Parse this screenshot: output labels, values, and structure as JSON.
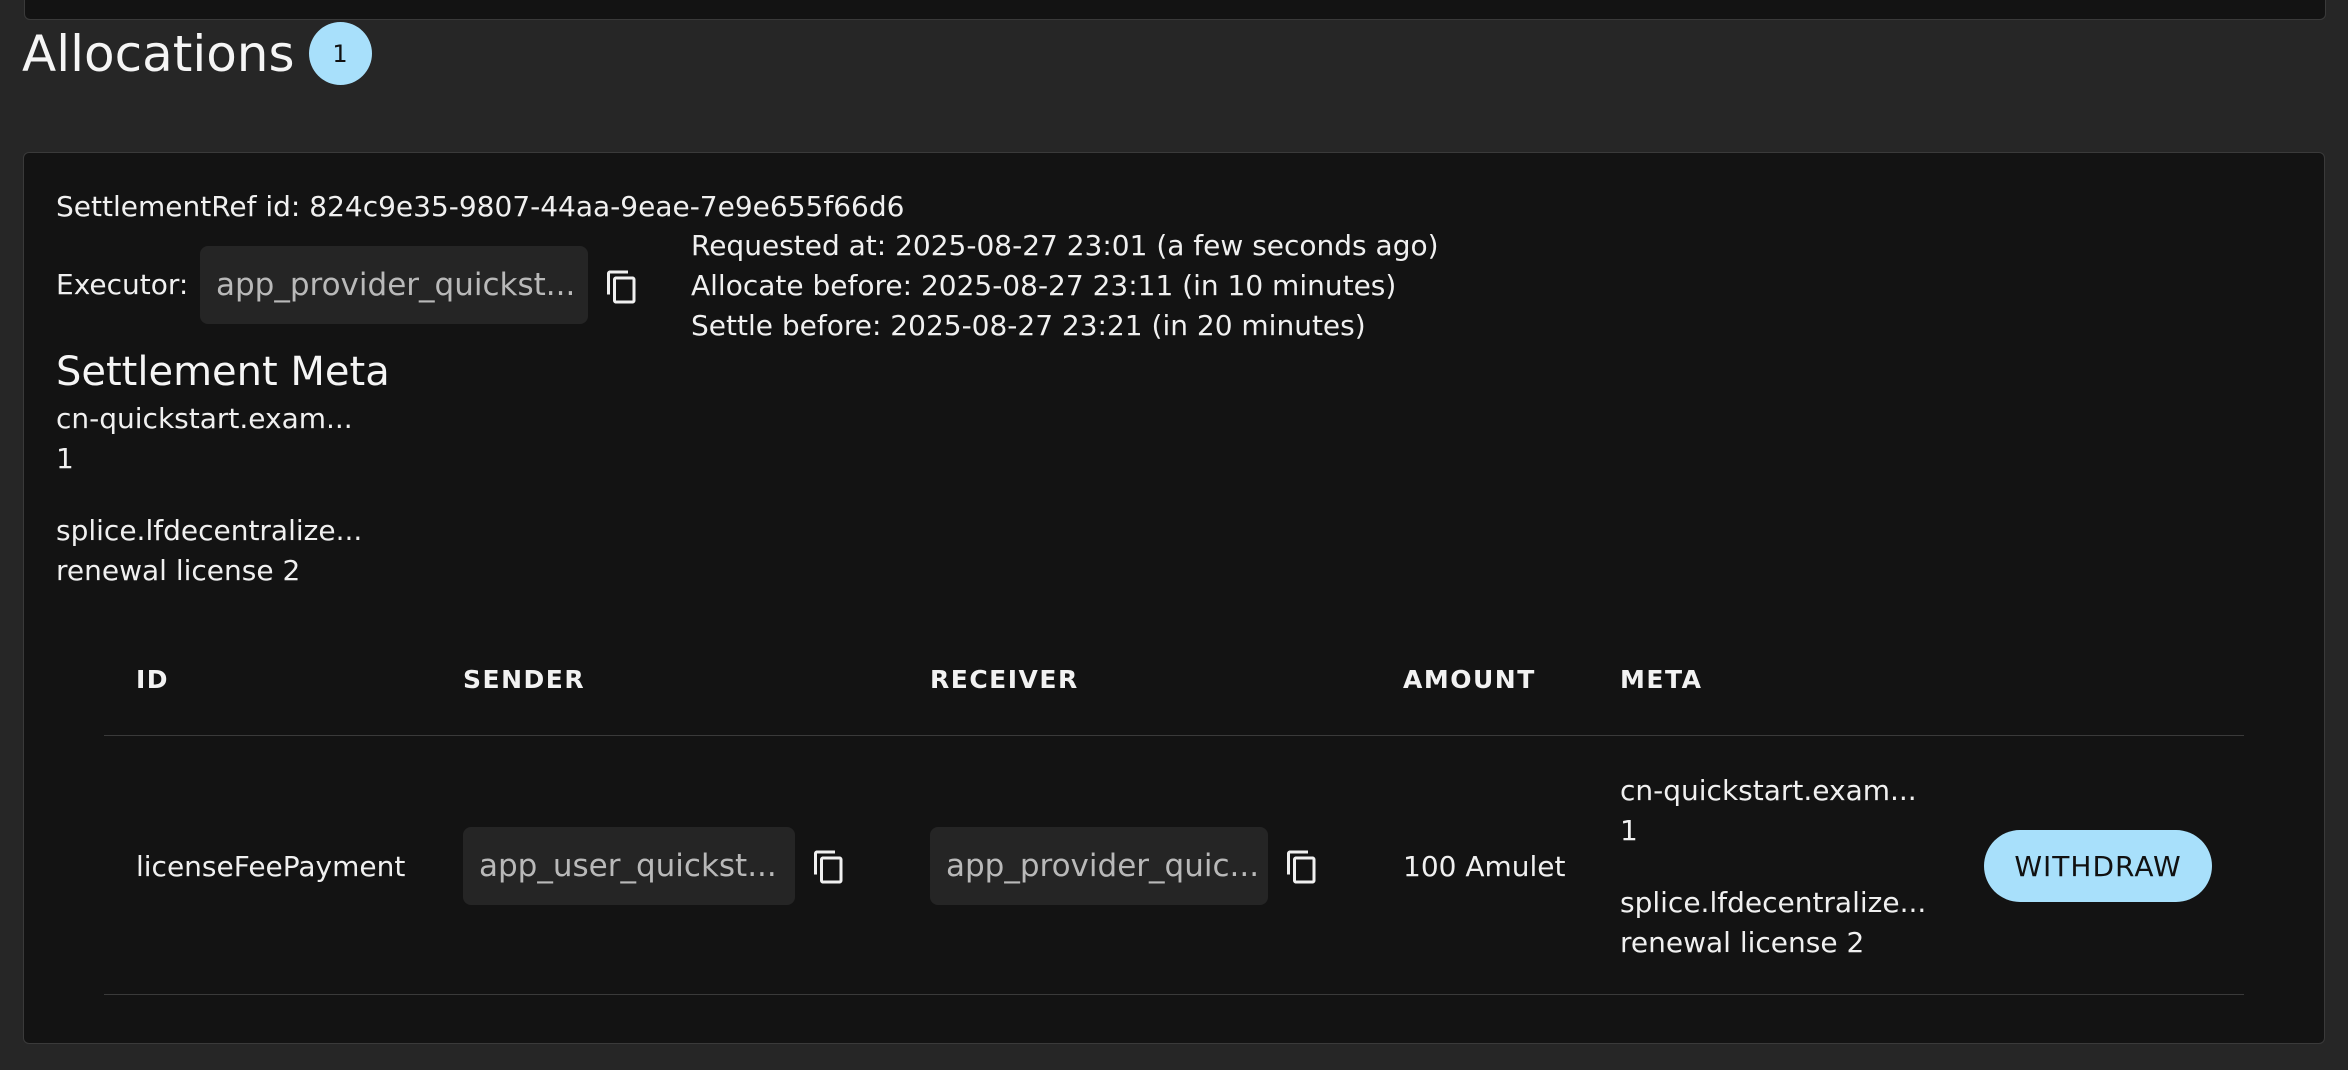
{
  "section": {
    "title": "Allocations",
    "count": "1"
  },
  "settlement": {
    "ref_label": "SettlementRef id: 824c9e35-9807-44aa-9eae-7e9e655f66d6",
    "executor_label": "Executor:",
    "executor_value": "app_provider_quickst...",
    "requested_at": "Requested at: 2025-08-27 23:01 (a few seconds ago)",
    "allocate_before": "Allocate before: 2025-08-27 23:11 (in 10 minutes)",
    "settle_before": "Settle before: 2025-08-27 23:21 (in 20 minutes)",
    "meta_title": "Settlement Meta",
    "meta": [
      {
        "key": "cn-quickstart.exam...",
        "value": "1"
      },
      {
        "key": "splice.lfdecentralize...",
        "value": "renewal license 2"
      }
    ]
  },
  "table": {
    "headers": [
      "ID",
      "SENDER",
      "RECEIVER",
      "AMOUNT",
      "META"
    ],
    "rows": [
      {
        "id": "licenseFeePayment",
        "sender": "app_user_quickst...",
        "receiver": "app_provider_quic...",
        "amount": "100 Amulet",
        "meta": [
          {
            "key": "cn-quickstart.exam...",
            "value": "1"
          },
          {
            "key": "splice.lfdecentralize...",
            "value": "renewal license 2"
          }
        ],
        "action_label": "WITHDRAW"
      }
    ]
  },
  "icons": {
    "copy": "copy-icon"
  },
  "colors": {
    "background": "#262626",
    "card": "#131313",
    "accent": "#a8e0fb"
  }
}
